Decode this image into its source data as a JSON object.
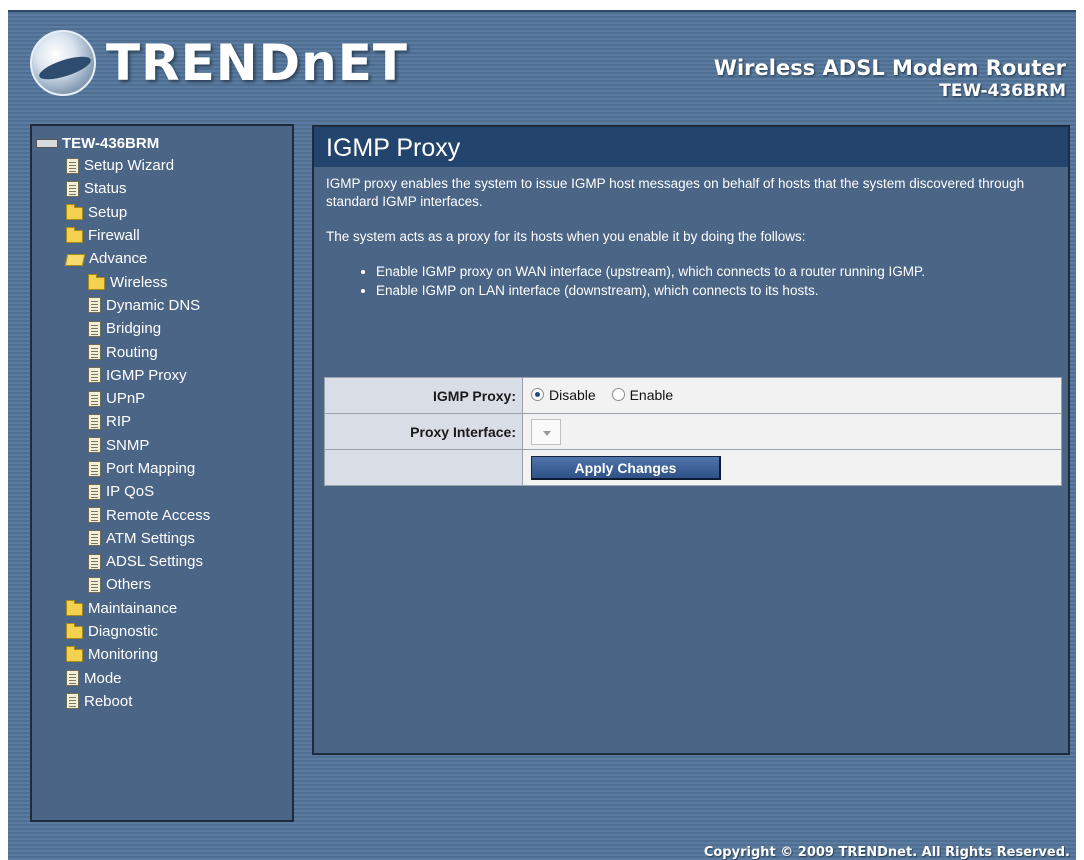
{
  "header": {
    "brand": "TRENDnET",
    "product_line": "Wireless ADSL Modem Router",
    "model": "TEW-436BRM"
  },
  "sidebar": {
    "root": "TEW-436BRM",
    "items": [
      {
        "label": "Setup Wizard",
        "icon": "document-icon",
        "level": 1
      },
      {
        "label": "Status",
        "icon": "document-icon",
        "level": 1
      },
      {
        "label": "Setup",
        "icon": "folder-icon",
        "level": 1
      },
      {
        "label": "Firewall",
        "icon": "folder-icon",
        "level": 1
      },
      {
        "label": "Advance",
        "icon": "folder-open-icon",
        "level": 1
      },
      {
        "label": "Wireless",
        "icon": "folder-icon",
        "level": 2
      },
      {
        "label": "Dynamic DNS",
        "icon": "document-icon",
        "level": 2
      },
      {
        "label": "Bridging",
        "icon": "document-icon",
        "level": 2
      },
      {
        "label": "Routing",
        "icon": "document-icon",
        "level": 2
      },
      {
        "label": "IGMP Proxy",
        "icon": "document-icon",
        "level": 2
      },
      {
        "label": "UPnP",
        "icon": "document-icon",
        "level": 2
      },
      {
        "label": "RIP",
        "icon": "document-icon",
        "level": 2
      },
      {
        "label": "SNMP",
        "icon": "document-icon",
        "level": 2
      },
      {
        "label": "Port Mapping",
        "icon": "document-icon",
        "level": 2
      },
      {
        "label": "IP QoS",
        "icon": "document-icon",
        "level": 2
      },
      {
        "label": "Remote Access",
        "icon": "document-icon",
        "level": 2
      },
      {
        "label": "ATM Settings",
        "icon": "document-icon",
        "level": 2
      },
      {
        "label": "ADSL Settings",
        "icon": "document-icon",
        "level": 2
      },
      {
        "label": "Others",
        "icon": "document-icon",
        "level": 2
      },
      {
        "label": "Maintainance",
        "icon": "folder-icon",
        "level": 1
      },
      {
        "label": "Diagnostic",
        "icon": "folder-icon",
        "level": 1
      },
      {
        "label": "Monitoring",
        "icon": "folder-icon",
        "level": 1
      },
      {
        "label": "Mode",
        "icon": "document-icon",
        "level": 1
      },
      {
        "label": "Reboot",
        "icon": "document-icon",
        "level": 1
      }
    ]
  },
  "main": {
    "title": "IGMP Proxy",
    "paragraph1": "IGMP proxy enables the system to issue IGMP host messages on behalf of hosts that the system discovered through standard IGMP interfaces.",
    "paragraph2": "The system acts as a proxy for its hosts when you enable it by doing the follows:",
    "bullets": [
      "Enable IGMP proxy on WAN interface (upstream), which connects to a router running IGMP.",
      "Enable IGMP on LAN interface (downstream), which connects to its hosts."
    ],
    "form": {
      "igmp_proxy_label": "IGMP Proxy:",
      "disable_label": "Disable",
      "enable_label": "Enable",
      "selected": "Disable",
      "proxy_interface_label": "Proxy Interface:",
      "proxy_interface_value": "",
      "apply_label": "Apply Changes"
    }
  },
  "footer": {
    "copyright": "Copyright © 2009 TRENDnet. All Rights Reserved."
  },
  "colors": {
    "background": "#5b7ca0",
    "panel": "#4b6587",
    "title_bar": "#23446c",
    "button": "#2f5288"
  }
}
